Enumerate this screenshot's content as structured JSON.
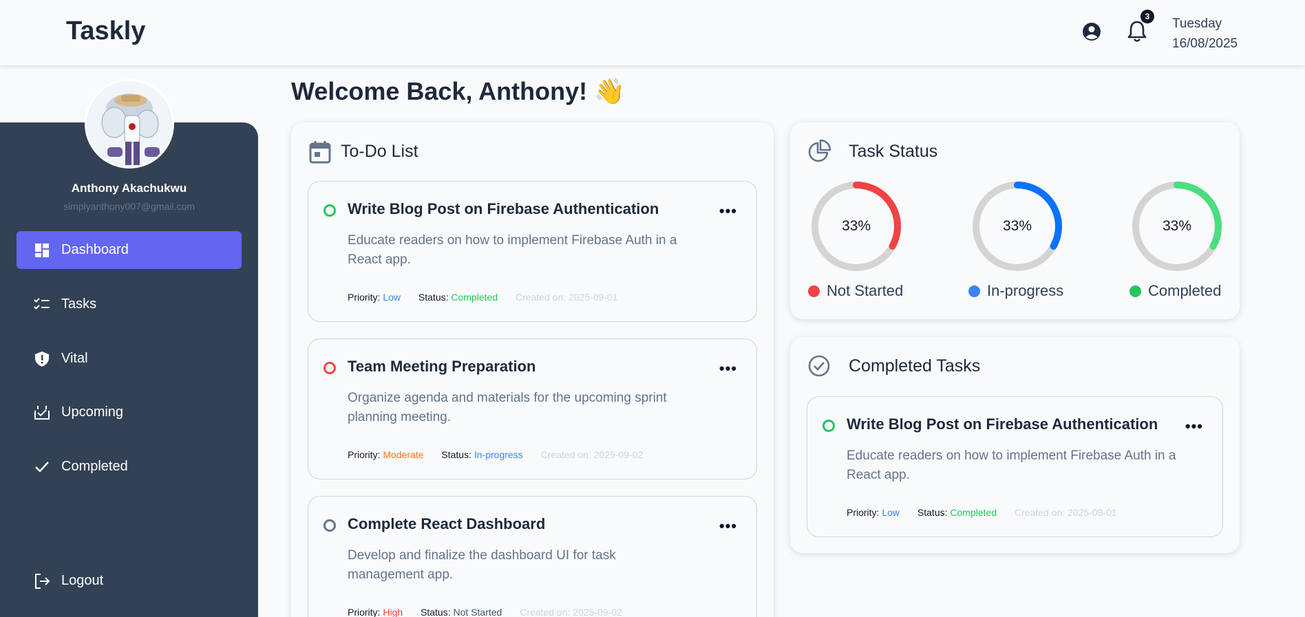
{
  "header": {
    "logo": "Taskly",
    "notification_count": "3",
    "day": "Tuesday",
    "date": "16/08/2025",
    "icons": [
      "user-circle-icon",
      "bell-icon"
    ]
  },
  "sidebar": {
    "user_name": "Anthony Akachukwu",
    "user_email": "simplyanthony007@gmail.com",
    "items": [
      {
        "label": "Dashboard",
        "icon": "dashboard-icon",
        "active": true
      },
      {
        "label": "Tasks",
        "icon": "checklist-icon",
        "active": false
      },
      {
        "label": "Vital",
        "icon": "shield-alert-icon",
        "active": false
      },
      {
        "label": "Upcoming",
        "icon": "calendar-upcoming-icon",
        "active": false
      },
      {
        "label": "Completed",
        "icon": "check-icon",
        "active": false
      }
    ],
    "logout": "Logout"
  },
  "main": {
    "welcome": "Welcome Back, Anthony! 👋",
    "todo": {
      "title": "To-Do List",
      "tasks": [
        {
          "title": "Write Blog Post on Firebase Authentication",
          "desc": "Educate readers on how to implement Firebase Auth in a React app.",
          "priority_label": "Priority:",
          "priority": "Low",
          "status_label": "Status:",
          "status": "Completed",
          "created": "Created on: 2025-09-01",
          "dot_color": "#22c55e",
          "priority_color": "#3b82f6",
          "status_color": "#22c55e"
        },
        {
          "title": "Team Meeting Preparation",
          "desc": "Organize agenda and materials for the upcoming sprint planning meeting.",
          "priority_label": "Priority:",
          "priority": "Moderate",
          "status_label": "Status:",
          "status": "In-progress",
          "created": "Created on: 2025-09-02",
          "dot_color": "#ef4444",
          "priority_color": "#f97316",
          "status_color": "#3b82f6"
        },
        {
          "title": "Complete React Dashboard",
          "desc": "Develop and finalize the dashboard UI for task management app.",
          "priority_label": "Priority:",
          "priority": "High",
          "status_label": "Status:",
          "status": "Not Started",
          "created": "Created on: 2025-09-02",
          "dot_color": "#64748b",
          "priority_color": "#ef4444",
          "status_color": "#475569"
        }
      ]
    },
    "task_status": {
      "title": "Task Status",
      "items": [
        {
          "pct": "33%",
          "fraction": 0.33,
          "label": "Not Started",
          "color": "#ef4444"
        },
        {
          "pct": "33%",
          "fraction": 0.33,
          "label": "In-progress",
          "color": "#0a72ff"
        },
        {
          "pct": "33%",
          "fraction": 0.33,
          "label": "Completed",
          "color": "#4ade80"
        }
      ]
    },
    "completed": {
      "title": "Completed Tasks",
      "task": {
        "title": "Write Blog Post on Firebase Authentication",
        "desc": "Educate readers on how to implement Firebase Auth in a React app.",
        "priority_label": "Priority:",
        "priority": "Low",
        "status_label": "Status:",
        "status": "Completed",
        "created": "Created on: 2025-09-01"
      }
    }
  }
}
